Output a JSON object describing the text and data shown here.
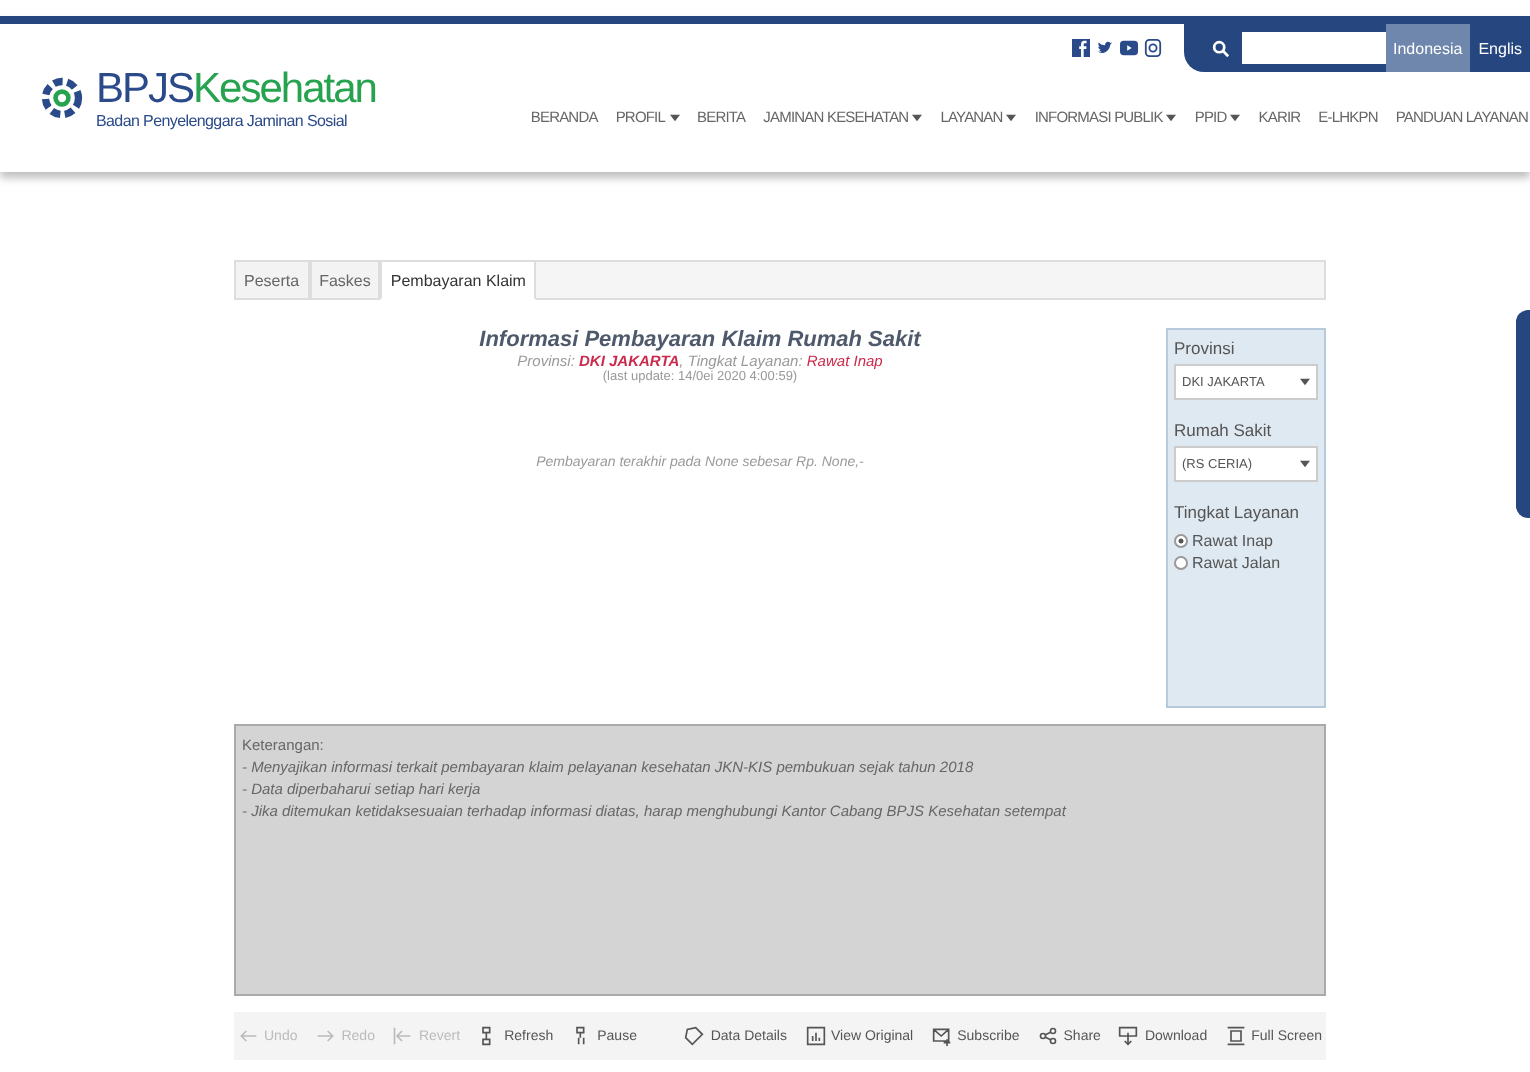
{
  "header": {
    "logo_title": "BPJS",
    "logo_title_accent": "Kesehatan",
    "logo_subtitle": "Badan Penyelenggara Jaminan Sosial",
    "languages": [
      {
        "label": "Indonesia",
        "selected": true
      },
      {
        "label": "Englis",
        "selected": false
      }
    ],
    "nav": [
      {
        "label": "BERANDA",
        "dropdown": false
      },
      {
        "label": "PROFIL",
        "dropdown": true
      },
      {
        "label": "BERITA",
        "dropdown": false
      },
      {
        "label": "JAMINAN KESEHATAN",
        "dropdown": true
      },
      {
        "label": "LAYANAN",
        "dropdown": true
      },
      {
        "label": "INFORMASI PUBLIK",
        "dropdown": true
      },
      {
        "label": "PPID",
        "dropdown": true
      },
      {
        "label": "KARIR",
        "dropdown": false
      },
      {
        "label": "E-LHKPN",
        "dropdown": false
      },
      {
        "label": "PANDUAN LAYANAN",
        "dropdown": false
      }
    ]
  },
  "tabs": [
    {
      "label": "Peserta",
      "selected": false
    },
    {
      "label": "Faskes",
      "selected": false
    },
    {
      "label": "Pembayaran Klaim",
      "selected": true
    }
  ],
  "report": {
    "title": "Informasi Pembayaran Klaim Rumah Sakit",
    "province_label": "Provinsi: ",
    "province": "DKI JAKARTA",
    "level_label": ", Tingkat Layanan: ",
    "level": "Rawat Inap",
    "updated": "(last update: 14/0ei 2020 4:00:59)",
    "message": "Pembayaran terakhir pada None sebesar Rp. None,-"
  },
  "filters": {
    "province_label": "Provinsi",
    "province": "DKI JAKARTA",
    "hospital_label": "Rumah Sakit",
    "hospital": "(RS CERIA)",
    "level_label": "Tingkat Layanan",
    "levels": [
      {
        "label": "Rawat Inap",
        "selected": true
      },
      {
        "label": "Rawat Jalan",
        "selected": false
      }
    ]
  },
  "notes": [
    "Keterangan:",
    "- Menyajikan informasi terkait pembayaran klaim pelayanan kesehatan JKN-KIS pembukuan sejak tahun 2018",
    "- Data diperbaharui setiap hari kerja",
    "- Jika ditemukan ketidaksesuaian terhadap informasi diatas, harap menghubungi Kantor Cabang BPJS Kesehatan setempat"
  ],
  "toolbar_left": [
    {
      "label": "Undo",
      "kind": "undo",
      "disabled": true
    },
    {
      "label": "Redo",
      "kind": "redo",
      "disabled": true
    },
    {
      "label": "Revert",
      "kind": "revert",
      "disabled": true
    },
    {
      "label": "Refresh",
      "kind": "refresh",
      "disabled": false
    },
    {
      "label": "Pause",
      "kind": "pause",
      "disabled": false
    }
  ],
  "toolbar_right": [
    {
      "label": "Data Details",
      "kind": "tag",
      "disabled": false
    },
    {
      "label": "View Original",
      "kind": "chart",
      "disabled": false
    },
    {
      "label": "Subscribe",
      "kind": "mail",
      "disabled": false
    },
    {
      "label": "Share",
      "kind": "share",
      "disabled": false
    },
    {
      "label": "Download",
      "kind": "download",
      "disabled": false
    },
    {
      "label": "Full Screen",
      "kind": "fullscreen",
      "disabled": false
    }
  ]
}
